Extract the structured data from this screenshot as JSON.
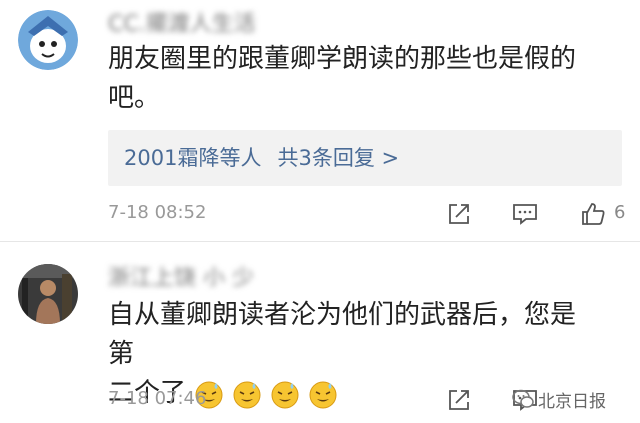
{
  "comments": [
    {
      "username": "CC.擺渡人生活",
      "text_line1": "朋友圈里的跟董卿学朗读的那些也是假的",
      "text_line2": "吧。",
      "reply_box": {
        "people": "2001霜降等人",
        "count_text": "共3条回复 >"
      },
      "timestamp": "7-18 08:52",
      "likes": "6",
      "avatar_icon": "cartoon-avatar-icon"
    },
    {
      "username": "浙江上饶 小 少",
      "text_line1": "自从董卿朗读者沦为他们的武器后，您是第",
      "text_line2": "二个了",
      "emoji_icon": "sweat-smile-emoji-icon",
      "emoji_count": 4,
      "timestamp": "7-18 07:46",
      "avatar_icon": "photo-avatar-icon"
    }
  ],
  "watermark": {
    "text": "北京日报",
    "icon": "wechat-icon"
  },
  "colors": {
    "link": "#4a6b96",
    "meta": "#999999",
    "reply_bg": "#f2f2f2"
  }
}
